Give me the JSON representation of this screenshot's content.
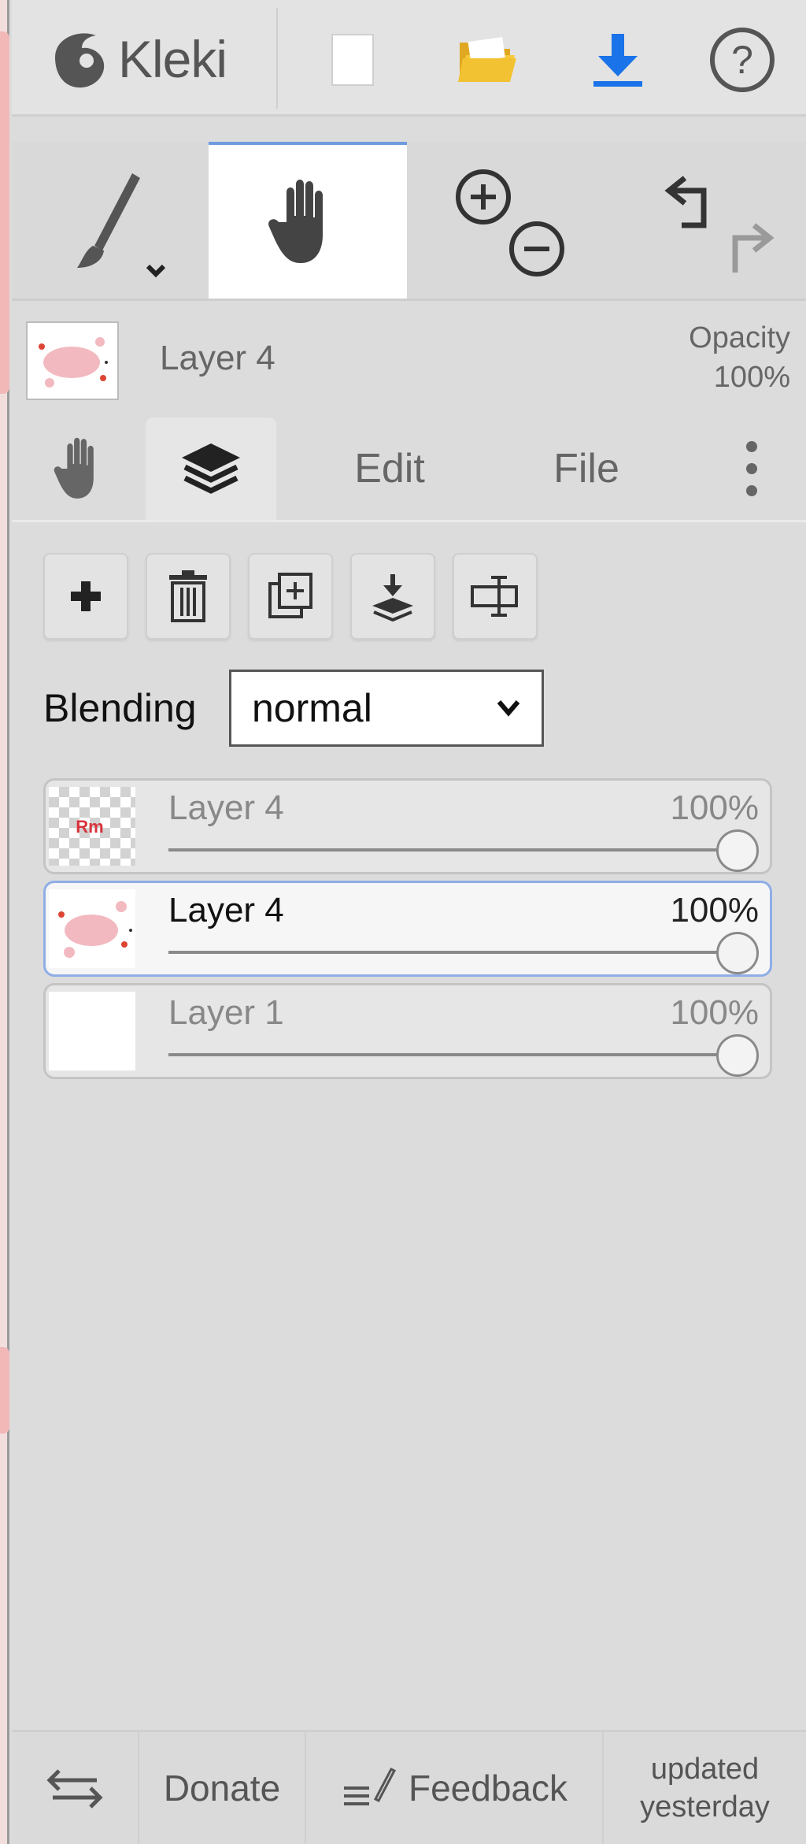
{
  "app": {
    "name": "Kleki"
  },
  "topbar": {
    "new_icon": "new-file-icon",
    "open_icon": "folder-open-icon",
    "save_icon": "download-icon",
    "help_icon": "help-icon"
  },
  "tools": {
    "brush_icon": "brush-icon",
    "hand_icon": "hand-icon",
    "zoom_in_icon": "zoom-in-icon",
    "zoom_out_icon": "zoom-out-icon",
    "undo_icon": "undo-icon",
    "redo_icon": "redo-icon"
  },
  "current_layer": {
    "name": "Layer 4",
    "opacity_label": "Opacity",
    "opacity_value": "100%"
  },
  "tabs": [
    {
      "label": "",
      "icon": "hand-icon"
    },
    {
      "label": "",
      "icon": "layers-icon"
    },
    {
      "label": "Edit"
    },
    {
      "label": "File"
    }
  ],
  "layer_actions": [
    "add-layer",
    "delete-layer",
    "duplicate-layer",
    "merge-down",
    "rename-layer"
  ],
  "blending": {
    "label": "Blending",
    "value": "normal"
  },
  "layers": [
    {
      "name": "Layer 4",
      "opacity": "100%",
      "opacity_fraction": 1.0,
      "selected": false
    },
    {
      "name": "Layer 4",
      "opacity": "100%",
      "opacity_fraction": 1.0,
      "selected": true
    },
    {
      "name": "Layer 1",
      "opacity": "100%",
      "opacity_fraction": 1.0,
      "selected": false
    }
  ],
  "footer": {
    "donate": "Donate",
    "feedback": "Feedback",
    "updated_line1": "updated",
    "updated_line2": "yesterday"
  },
  "colors": {
    "accent": "#6f9be0",
    "panel_bg": "#dcdcdc",
    "folder": "#f2c232",
    "download": "#1a73e8"
  }
}
